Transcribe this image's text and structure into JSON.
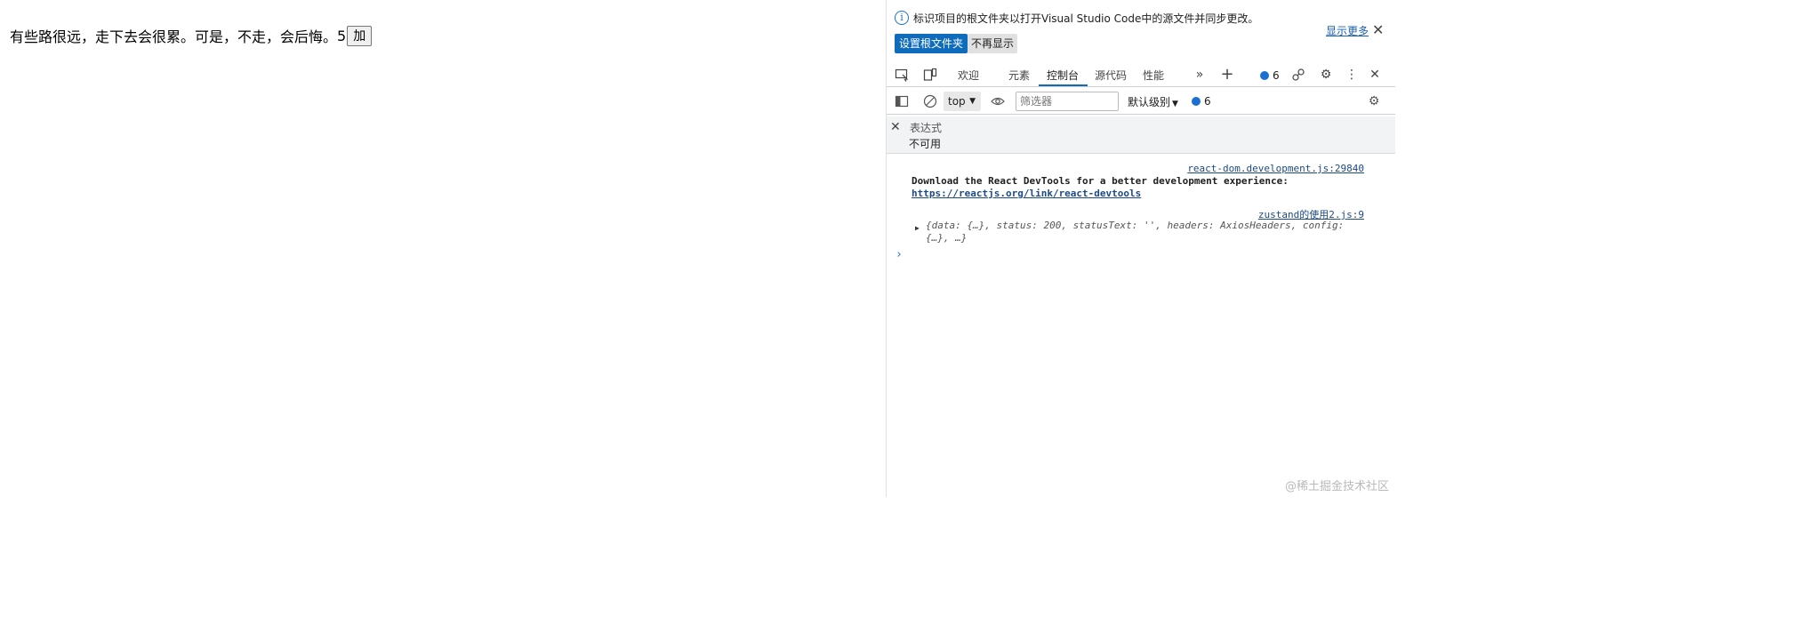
{
  "page": {
    "text": "有些路很远，走下去会很累。可是，不走，会后悔。",
    "count": "5",
    "button_label": "加"
  },
  "infobar": {
    "message": "标识项目的根文件夹以打开Visual Studio Code中的源文件并同步更改。",
    "show_more": "显示更多",
    "set_root_button": "设置根文件夹",
    "dont_show_button": "不再显示"
  },
  "tabs": {
    "welcome": "欢迎",
    "elements": "元素",
    "console": "控制台",
    "sources": "源代码",
    "performance": "性能",
    "issues_count": "6"
  },
  "toolbar": {
    "context": "top",
    "filter_placeholder": "筛选器",
    "level": "默认级别",
    "issues_count": "6"
  },
  "expression": {
    "label": "表达式",
    "value": "不可用"
  },
  "console": {
    "msg1_source": "react-dom.development.js:29840",
    "msg1_text": "Download the React DevTools for a better development experience: ",
    "msg1_link": "https://reactjs.org/link/react-devtools",
    "msg2_source": "zustand的使用2.js:9",
    "msg2_obj": "{data: {…}, status: 200, statusText: '', headers: AxiosHeaders, config: {…}, …}"
  },
  "watermark": "@稀土掘金技术社区",
  "colors": {
    "accent": "#0f6cbd",
    "link": "#1a4a8a"
  }
}
